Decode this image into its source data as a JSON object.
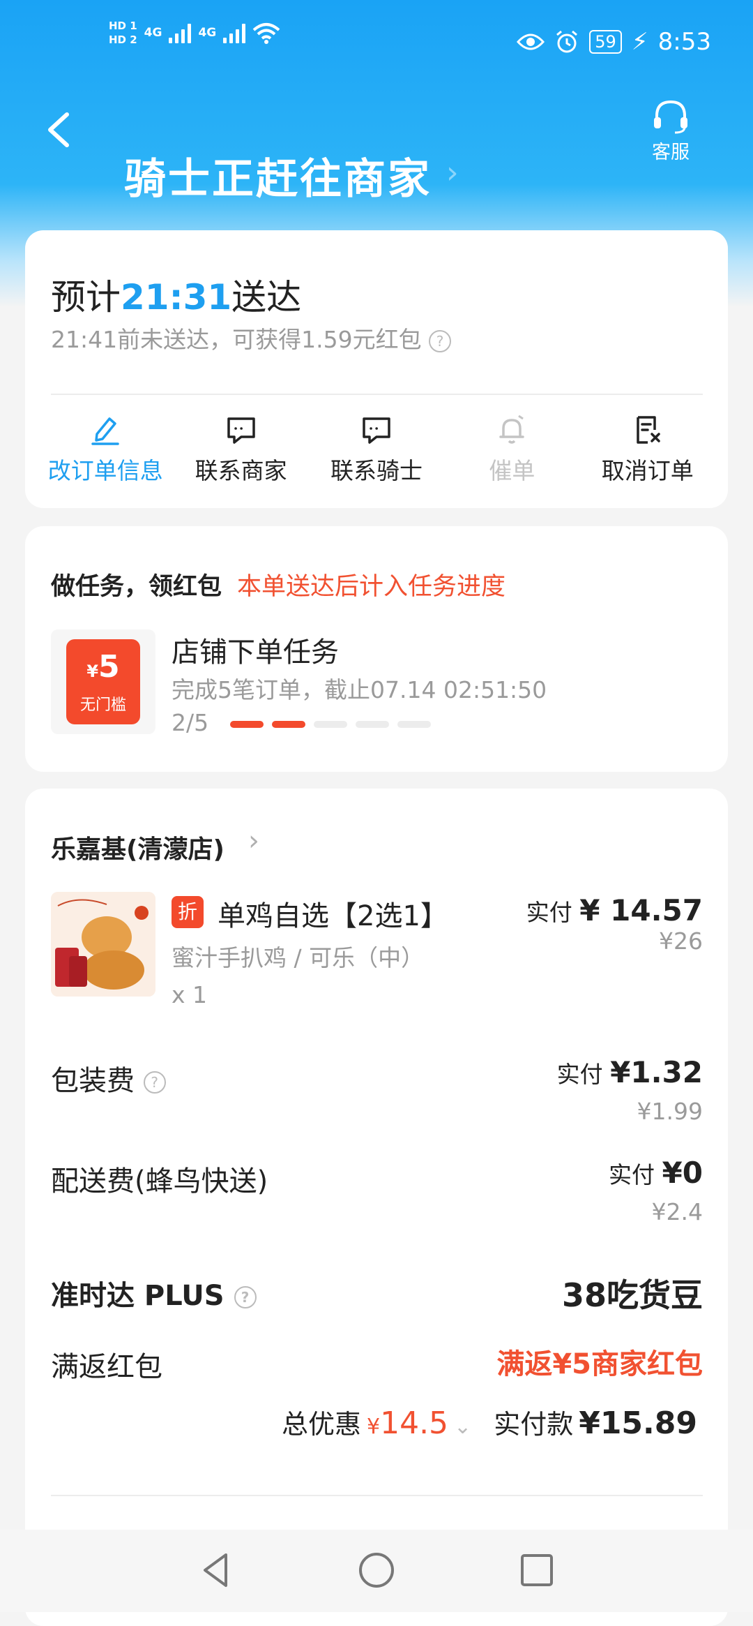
{
  "status_bar": {
    "hd1": "HD 1",
    "hd2": "HD 2",
    "net1": "4G",
    "net2": "4G",
    "battery": "59",
    "time": "8:53"
  },
  "header": {
    "title": "骑士正赶往商家",
    "customer_service": "客服"
  },
  "delivery": {
    "eta_prefix": "预计",
    "eta_time": "21:31",
    "eta_suffix": "送达",
    "note": "21:41前未送达，可获得1.59元红包"
  },
  "actions": [
    {
      "label": "改订单信息",
      "icon": "edit-icon",
      "state": "active"
    },
    {
      "label": "联系商家",
      "icon": "chat-icon",
      "state": "normal"
    },
    {
      "label": "联系骑士",
      "icon": "chat-icon",
      "state": "normal"
    },
    {
      "label": "催单",
      "icon": "bell-icon",
      "state": "disabled"
    },
    {
      "label": "取消订单",
      "icon": "cancel-order-icon",
      "state": "normal"
    }
  ],
  "task": {
    "heading": "做任务，领红包",
    "hint": "本单送达后计入任务进度",
    "coupon_symbol": "¥",
    "coupon_amount": "5",
    "coupon_label": "无门槛",
    "title": "店铺下单任务",
    "desc": "完成5笔订单，截止07.14 02:51:50",
    "progress_text": "2/5",
    "progress_done": 2,
    "progress_total": 5
  },
  "order": {
    "shop_name": "乐嘉基(清濛店)",
    "item": {
      "badge": "折",
      "name": "单鸡自选【2选1】",
      "spec": "蜜汁手扒鸡 / 可乐（中）",
      "qty": "x 1",
      "paid_label": "实付",
      "paid_price": "¥ 14.57",
      "orig_price": "¥26"
    },
    "packaging": {
      "label": "包装费",
      "paid_label": "实付",
      "paid_price": "¥1.32",
      "orig_price": "¥1.99"
    },
    "delivery_fee": {
      "label": "配送费(蜂鸟快送)",
      "paid_label": "实付",
      "paid_price": "¥0",
      "orig_price": "¥2.4"
    },
    "ontime": {
      "label": "准时达 PLUS",
      "value": "38吃货豆"
    },
    "cashback": {
      "label": "满返红包",
      "value": "满返¥5商家红包"
    },
    "totals": {
      "discount_label": "总优惠",
      "discount_symbol": "¥",
      "discount_value": "14.5",
      "pay_label": "实付款",
      "pay_value": "¥15.89"
    }
  },
  "colors": {
    "accent_blue": "#1e9ff0",
    "accent_red": "#f15131"
  }
}
